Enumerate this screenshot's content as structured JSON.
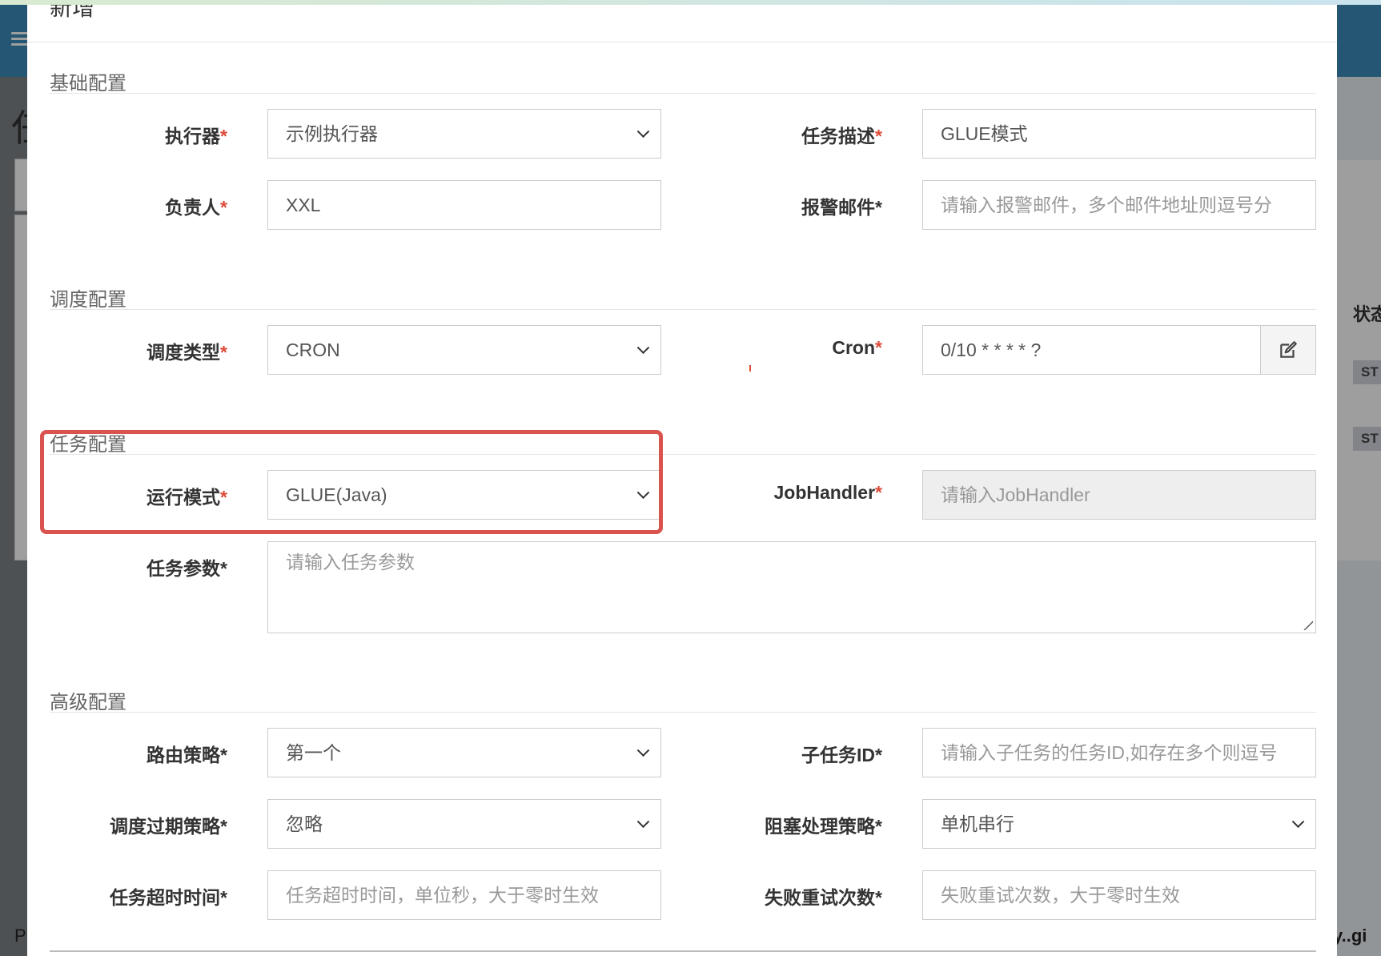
{
  "modal": {
    "title": "新增"
  },
  "sections": {
    "basic": "基础配置",
    "schedule": "调度配置",
    "task": "任务配置",
    "advanced": "高级配置"
  },
  "form": {
    "executor": {
      "label": "执行器",
      "value": "示例执行器"
    },
    "job_desc": {
      "label": "任务描述",
      "value": "GLUE模式"
    },
    "author": {
      "label": "负责人",
      "value": "XXL"
    },
    "alarm_email": {
      "label": "报警邮件*",
      "placeholder": "请输入报警邮件，多个邮件地址则逗号分"
    },
    "schedule_type": {
      "label": "调度类型",
      "value": "CRON"
    },
    "cron": {
      "label": "Cron",
      "value": "0/10 * * * * ?"
    },
    "glue_type": {
      "label": "运行模式",
      "value": "GLUE(Java)"
    },
    "job_handler": {
      "label": "JobHandler",
      "placeholder": "请输入JobHandler"
    },
    "job_param": {
      "label": "任务参数*",
      "placeholder": "请输入任务参数"
    },
    "route_strategy": {
      "label": "路由策略*",
      "value": "第一个"
    },
    "child_job_id": {
      "label": "子任务ID*",
      "placeholder": "请输入子任务的任务ID,如存在多个则逗号"
    },
    "misfire_strategy": {
      "label": "调度过期策略*",
      "value": "忽略"
    },
    "block_strategy": {
      "label": "阻塞处理策略*",
      "value": "单机串行"
    },
    "timeout": {
      "label": "任务超时时间*",
      "placeholder": "任务超时时间，单位秒，大于零时生效"
    },
    "fail_retry": {
      "label": "失败重试次数*",
      "placeholder": "失败重试次数，大于零时生效"
    }
  },
  "background": {
    "right_header": "状态",
    "badge1": "ST",
    "badge2": "ST",
    "left_title": "任",
    "footer_left": "P",
    "footer_right": "y..gi"
  },
  "icons": {
    "cron_edit": "edit-icon"
  },
  "colors": {
    "required": "#dd4b39",
    "highlight_border": "#d9534f",
    "header": "#3c8dbc"
  }
}
